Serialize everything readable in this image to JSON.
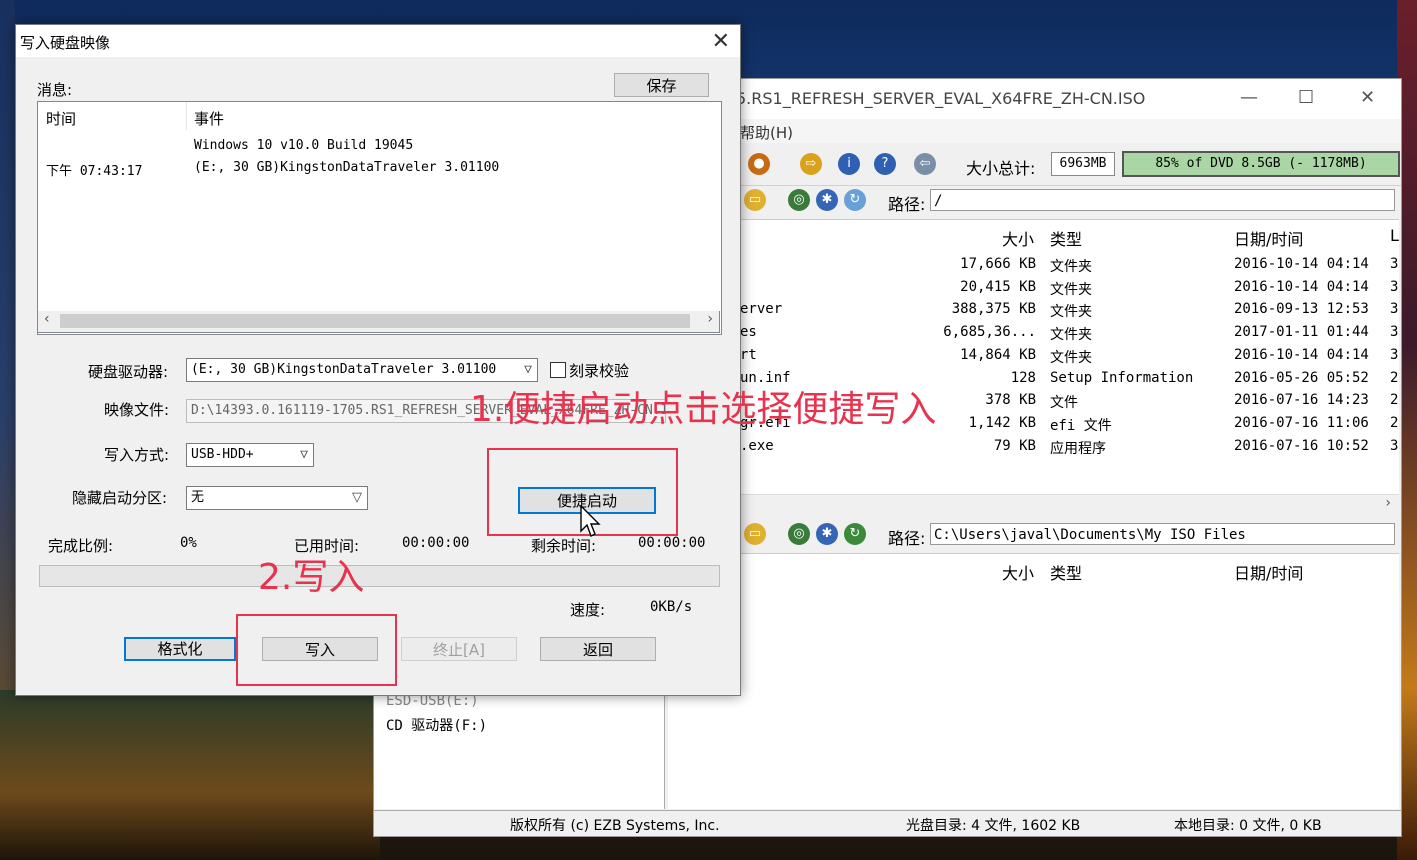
{
  "app": {
    "title": "5.RS1_REFRESH_SERVER_EVAL_X64FRE_ZH-CN.ISO",
    "menu_help": "帮助(H)",
    "size_label": "大小总计:",
    "size_value": "6963MB",
    "size_bar": "85% of DVD 8.5GB (- 1178MB)",
    "path_label": "路径:",
    "top_path": "/",
    "bottom_path": "C:\\Users\\javal\\Documents\\My ISO Files",
    "columns": {
      "size": "大小",
      "type": "类型",
      "date": "日期/时间",
      "extra": "L"
    },
    "files": [
      {
        "name": "",
        "size": "17,666 KB",
        "type": "文件夹",
        "date": "2016-10-14 04:14",
        "extra": "3"
      },
      {
        "name": "",
        "size": "20,415 KB",
        "type": "文件夹",
        "date": "2016-10-14 04:14",
        "extra": "3"
      },
      {
        "name": "erver",
        "size": "388,375 KB",
        "type": "文件夹",
        "date": "2016-09-13 12:53",
        "extra": "3"
      },
      {
        "name": "es",
        "size": "6,685,36...",
        "type": "文件夹",
        "date": "2017-01-11 01:44",
        "extra": "3"
      },
      {
        "name": "rt",
        "size": "14,864 KB",
        "type": "文件夹",
        "date": "2016-10-14 04:14",
        "extra": "3"
      },
      {
        "name": "un.inf",
        "size": "128",
        "type": "Setup Information",
        "date": "2016-05-26 05:52",
        "extra": "2"
      },
      {
        "name": "",
        "size": "378 KB",
        "type": "文件",
        "date": "2016-07-16 14:23",
        "extra": "2"
      },
      {
        "name": "gr.efi",
        "size": "1,142 KB",
        "type": "efi 文件",
        "date": "2016-07-16 11:06",
        "extra": "2"
      },
      {
        "name": ".exe",
        "size": "79 KB",
        "type": "应用程序",
        "date": "2016-07-16 10:52",
        "extra": "3"
      }
    ],
    "tree_items": [
      "ESD-USB(E:)",
      "CD 驱动器(F:)"
    ],
    "status_copyright": "版权所有 (c) EZB Systems, Inc.",
    "status_disc": "光盘目录: 4 文件, 1602 KB",
    "status_local": "本地目录: 0 文件, 0 KB"
  },
  "dialog": {
    "title": "写入硬盘映像",
    "messages_label": "消息:",
    "save_button": "保存",
    "log_headers": {
      "time": "时间",
      "event": "事件"
    },
    "log_rows": [
      {
        "time": "",
        "event": "Windows 10 v10.0 Build 19045"
      },
      {
        "time": "下午 07:43:17",
        "event": "(E:, 30 GB)KingstonDataTraveler 3.01100"
      }
    ],
    "drive_label": "硬盘驱动器:",
    "drive_value": "(E:, 30 GB)KingstonDataTraveler 3.01100",
    "verify_label": "刻录校验",
    "image_label": "映像文件:",
    "image_value": "D:\\14393.0.161119-1705.RS1_REFRESH_SERVER_EVAL_X64FRE_ZH-CN.ISO",
    "write_method_label": "写入方式:",
    "write_method_value": "USB-HDD+",
    "hidden_partition_label": "隐藏启动分区:",
    "hidden_partition_value": "无",
    "quick_boot_button": "便捷启动",
    "progress_label": "完成比例:",
    "progress_value": "0%",
    "elapsed_label": "已用时间:",
    "elapsed_value": "00:00:00",
    "remaining_label": "剩余时间:",
    "remaining_value": "00:00:00",
    "speed_label": "速度:",
    "speed_value": "0KB/s",
    "format_button": "格式化",
    "write_button": "写入",
    "abort_button": "终止[A]",
    "back_button": "返回",
    "progress_fraction": 0
  },
  "annotations": {
    "step1": "1.便捷启动点击选择便捷写入",
    "step2": "2.写入"
  },
  "colors": {
    "annotation": "#e8334f",
    "focus": "#0078d7",
    "size_bar": "#a9d6a4"
  }
}
